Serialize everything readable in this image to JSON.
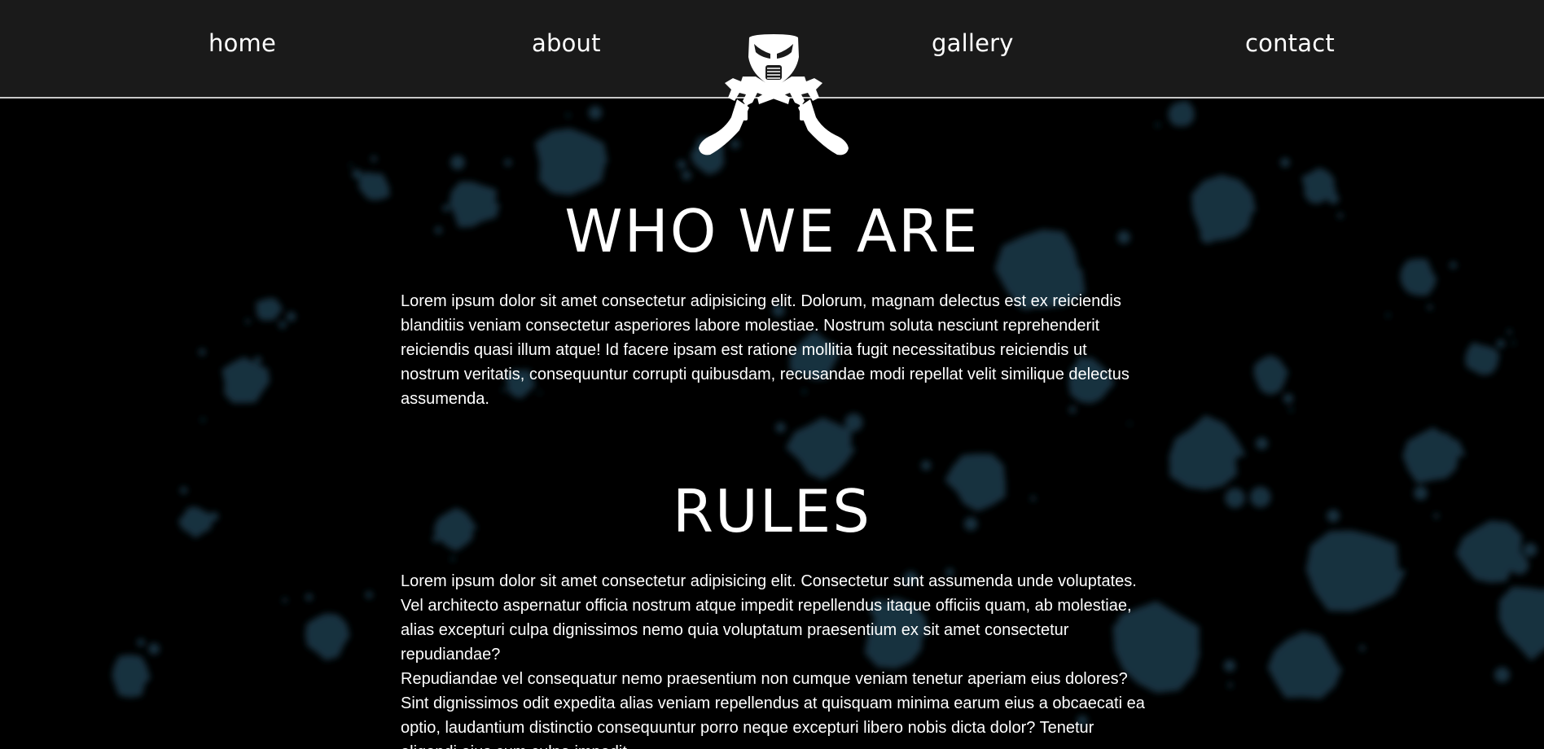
{
  "nav": {
    "home": "home",
    "about": "about",
    "gallery": "gallery",
    "contact": "contact"
  },
  "logo": {
    "icon": "paintball-mask-crossed-markers-icon"
  },
  "sections": {
    "who_we_are": {
      "title": "WHO WE ARE",
      "text": "Lorem ipsum dolor sit amet consectetur adipisicing elit. Dolorum, magnam delectus est ex reiciendis blanditiis veniam consectetur asperiores labore molestiae. Nostrum soluta nesciunt reprehenderit reiciendis quasi illum atque! Id facere ipsam est ratione mollitia fugit necessitatibus reiciendis ut nostrum veritatis, consequuntur corrupti quibusdam, recusandae modi repellat velit similique delectus assumenda."
    },
    "rules": {
      "title": "RULES",
      "paragraph_1": "Lorem ipsum dolor sit amet consectetur adipisicing elit. Consectetur sunt assumenda unde voluptates. Vel architecto aspernatur officia nostrum atque impedit repellendus itaque officiis quam, ab molestiae, alias excepturi culpa dignissimos nemo quia voluptatum praesentium ex sit amet consectetur repudiandae?",
      "paragraph_2": "Repudiandae vel consequatur nemo praesentium non cumque veniam tenetur aperiam eius dolores? Sint dignissimos odit expedita alias veniam repellendus at quisquam minima earum eius a obcaecati ea optio, laudantium distinctio consequuntur porro neque excepturi libero nobis dicta dolor? Tenetur eligendi eius cum culpa impedit."
    }
  },
  "colors": {
    "navbar_bg": "#1a1a1a",
    "page_bg": "#000000",
    "splatter": "#1b3a4b",
    "text": "#ffffff"
  }
}
